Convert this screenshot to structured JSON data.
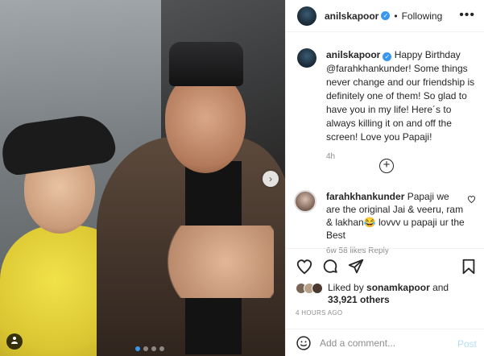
{
  "post": {
    "author": "anilskapoor",
    "separator": "•",
    "follow_status": "Following",
    "more_icon": "more-horizontal-icon",
    "verified_mark": "✓"
  },
  "caption": {
    "author": "anilskapoor",
    "body": "Happy Birthday @farahkhankunder! Some things never change and our friendship is definitely one of them! So glad to have you in my life! Here´s to always killing it on and off the screen! Love you Papaji!",
    "time": "4h"
  },
  "load_more": "+",
  "comment": {
    "author": "farahkhankunder",
    "body": "Papaji we are the original Jai & veeru, ram & lakhan😂 lovvv u papaji ur the Best",
    "meta": "6w  58 likes  Reply"
  },
  "likes": {
    "prefix": "Liked by",
    "first_user": "sonamkapoor",
    "conjunction": "and",
    "count": "33,921 others"
  },
  "timestamp": "4 HOURS AGO",
  "comment_box": {
    "placeholder": "Add a comment...",
    "post_label": "Post"
  },
  "carousel": {
    "next_glyph": "›",
    "slide_count": 4,
    "active_index": 0
  },
  "colors": {
    "accent": "#3897f0",
    "post_disabled": "#b2dffc",
    "muted": "#8e8e8e"
  }
}
